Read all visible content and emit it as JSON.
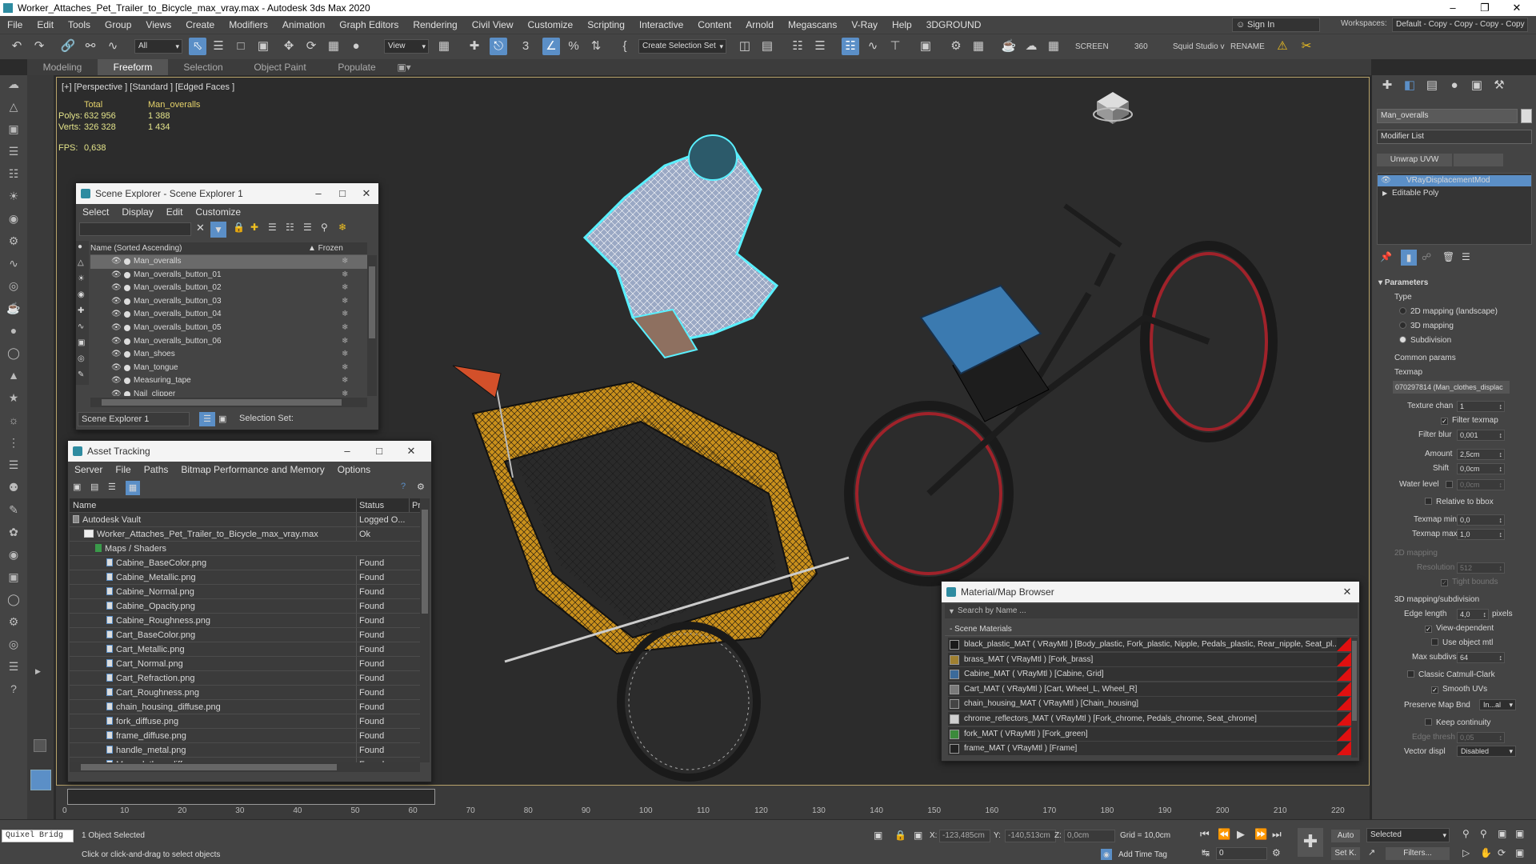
{
  "window": {
    "title": "Worker_Attaches_Pet_Trailer_to_Bicycle_max_vray.max - Autodesk 3ds Max 2020"
  },
  "menu": [
    "File",
    "Edit",
    "Tools",
    "Group",
    "Views",
    "Create",
    "Modifiers",
    "Animation",
    "Graph Editors",
    "Rendering",
    "Civil View",
    "Customize",
    "Scripting",
    "Interactive",
    "Content",
    "Arnold",
    "Megascans",
    "V-Ray",
    "Help",
    "3DGROUND"
  ],
  "signin": {
    "label": "Sign In"
  },
  "workspaces": {
    "label": "Workspaces:",
    "value": "Default - Copy - Copy - Copy - Copy"
  },
  "toolbar": {
    "filter": "All",
    "refcoord": "View",
    "named_sel": "Create Selection Set",
    "screen": "SCREEN",
    "num360": "360",
    "squid": "Squid Studio v",
    "rename": "RENAME"
  },
  "ribbon": [
    "Modeling",
    "Freeform",
    "Selection",
    "Object Paint",
    "Populate"
  ],
  "viewport": {
    "label": "[+] [Perspective ] [Standard ] [Edged Faces ]",
    "stats": {
      "h_total": "Total",
      "h_obj": "Man_overalls",
      "polys_lbl": "Polys:",
      "polys_total": "632 956",
      "polys_obj": "1 388",
      "verts_lbl": "Verts:",
      "verts_total": "326 328",
      "verts_obj": "1 434",
      "fps_lbl": "FPS:",
      "fps_val": "0,638"
    }
  },
  "scene_explorer": {
    "title": "Scene Explorer - Scene Explorer 1",
    "menu": [
      "Select",
      "Display",
      "Edit",
      "Customize"
    ],
    "col_name": "Name (Sorted Ascending)",
    "col_frozen": "▲ Frozen",
    "items": [
      "Man_overalls",
      "Man_overalls_button_01",
      "Man_overalls_button_02",
      "Man_overalls_button_03",
      "Man_overalls_button_04",
      "Man_overalls_button_05",
      "Man_overalls_button_06",
      "Man_shoes",
      "Man_tongue",
      "Measuring_tape",
      "Nail_clipper"
    ],
    "footer_name": "Scene Explorer 1",
    "selection_set": "Selection Set:"
  },
  "asset_tracking": {
    "title": "Asset Tracking",
    "menu": [
      "Server",
      "File",
      "Paths",
      "Bitmap Performance and Memory",
      "Options"
    ],
    "col_name": "Name",
    "col_status": "Status",
    "col_pr": "Pr",
    "rows": [
      {
        "name": "Autodesk Vault",
        "status": "Logged O...",
        "indent": 1,
        "icon": "vault"
      },
      {
        "name": "Worker_Attaches_Pet_Trailer_to_Bicycle_max_vray.max",
        "status": "Ok",
        "indent": 2,
        "icon": "max"
      },
      {
        "name": "Maps / Shaders",
        "status": "",
        "indent": 3,
        "icon": "maps"
      },
      {
        "name": "Cabine_BaseColor.png",
        "status": "Found",
        "indent": 4,
        "icon": "file"
      },
      {
        "name": "Cabine_Metallic.png",
        "status": "Found",
        "indent": 4,
        "icon": "file"
      },
      {
        "name": "Cabine_Normal.png",
        "status": "Found",
        "indent": 4,
        "icon": "file"
      },
      {
        "name": "Cabine_Opacity.png",
        "status": "Found",
        "indent": 4,
        "icon": "file"
      },
      {
        "name": "Cabine_Roughness.png",
        "status": "Found",
        "indent": 4,
        "icon": "file"
      },
      {
        "name": "Cart_BaseColor.png",
        "status": "Found",
        "indent": 4,
        "icon": "file"
      },
      {
        "name": "Cart_Metallic.png",
        "status": "Found",
        "indent": 4,
        "icon": "file"
      },
      {
        "name": "Cart_Normal.png",
        "status": "Found",
        "indent": 4,
        "icon": "file"
      },
      {
        "name": "Cart_Refraction.png",
        "status": "Found",
        "indent": 4,
        "icon": "file"
      },
      {
        "name": "Cart_Roughness.png",
        "status": "Found",
        "indent": 4,
        "icon": "file"
      },
      {
        "name": "chain_housing_diffuse.png",
        "status": "Found",
        "indent": 4,
        "icon": "file"
      },
      {
        "name": "fork_diffuse.png",
        "status": "Found",
        "indent": 4,
        "icon": "file"
      },
      {
        "name": "frame_diffuse.png",
        "status": "Found",
        "indent": 4,
        "icon": "file"
      },
      {
        "name": "handle_metal.png",
        "status": "Found",
        "indent": 4,
        "icon": "file"
      },
      {
        "name": "Man_clothes_diffuse.png",
        "status": "Found",
        "indent": 4,
        "icon": "file"
      }
    ]
  },
  "material_browser": {
    "title": "Material/Map Browser",
    "search": "Search by Name ...",
    "group": "- Scene Materials",
    "items": [
      "black_plastic_MAT  ( VRayMtl )  [Body_plastic, Fork_plastic, Nipple, Pedals_plastic, Rear_nipple, Seat_pl...",
      "brass_MAT  ( VRayMtl )  [Fork_brass]",
      "Cabine_MAT  ( VRayMtl )  [Cabine, Grid]",
      "Cart_MAT  ( VRayMtl )  [Cart, Wheel_L, Wheel_R]",
      "chain_housing_MAT  ( VRayMtl )  [Chain_housing]",
      "chrome_reflectors_MAT  ( VRayMtl )  [Fork_chrome, Pedals_chrome, Seat_chrome]",
      "fork_MAT  ( VRayMtl )  [Fork_green]",
      "frame_MAT  ( VRayMtl )  [Frame]"
    ]
  },
  "command_panel": {
    "object_name": "Man_overalls",
    "modifier_list": "Modifier List",
    "unwrap": "Unwrap UVW",
    "stack": [
      "VRayDisplacementMod",
      "Editable Poly"
    ],
    "params": "Parameters",
    "type_lbl": "Type",
    "type_opts": [
      "2D mapping (landscape)",
      "3D mapping",
      "Subdivision"
    ],
    "common": "Common params",
    "texmap_lbl": "Texmap",
    "texmap_val": "070297814 (Man_clothes_displac",
    "tex_chan_lbl": "Texture chan",
    "tex_chan_val": "1",
    "filter_texmap": "Filter texmap",
    "filter_blur_lbl": "Filter blur",
    "filter_blur_val": "0,001",
    "amount_lbl": "Amount",
    "amount_val": "2,5cm",
    "shift_lbl": "Shift",
    "shift_val": "0,0cm",
    "water_lbl": "Water level",
    "water_val": "0,0cm",
    "rel_bbox": "Relative to bbox",
    "tmin_lbl": "Texmap min",
    "tmin_val": "0,0",
    "tmax_lbl": "Texmap max",
    "tmax_val": "1,0",
    "map2d": "2D mapping",
    "res_lbl": "Resolution",
    "res_val": "512",
    "tight": "Tight bounds",
    "map3d": "3D mapping/subdivision",
    "edge_lbl": "Edge length",
    "edge_val": "4,0",
    "pixels": "pixels",
    "view_dep": "View-dependent",
    "use_obj": "Use object mtl",
    "max_sub_lbl": "Max subdivs",
    "max_sub_val": "64",
    "catmull": "Classic Catmull-Clark",
    "smooth_uv": "Smooth UVs",
    "preserve_lbl": "Preserve Map Bnd",
    "preserve_val": "In...al",
    "keep": "Keep continuity",
    "edge_th_lbl": "Edge thresh",
    "edge_th_val": "0,05",
    "vec_lbl": "Vector displ",
    "vec_val": "Disabled"
  },
  "timeline": {
    "ticks": [
      "0",
      "10",
      "20",
      "30",
      "40",
      "50",
      "60",
      "70",
      "80",
      "90",
      "100",
      "110",
      "120",
      "130",
      "140",
      "150",
      "160",
      "170",
      "180",
      "190",
      "200",
      "210",
      "220"
    ]
  },
  "status": {
    "quixel": "Quixel Bridg",
    "selected": "1 Object Selected",
    "hint": "Click or click-and-drag to select objects",
    "x_lbl": "X:",
    "x_val": "-123,485cm",
    "y_lbl": "Y:",
    "y_val": "-140,513cm",
    "z_lbl": "Z:",
    "z_val": "0,0cm",
    "grid": "Grid = 10,0cm",
    "add_time_tag": "Add Time Tag",
    "auto": "Auto",
    "selected_dd": "Selected",
    "setk": "Set K.",
    "filters": "Filters...",
    "frame": "0"
  }
}
